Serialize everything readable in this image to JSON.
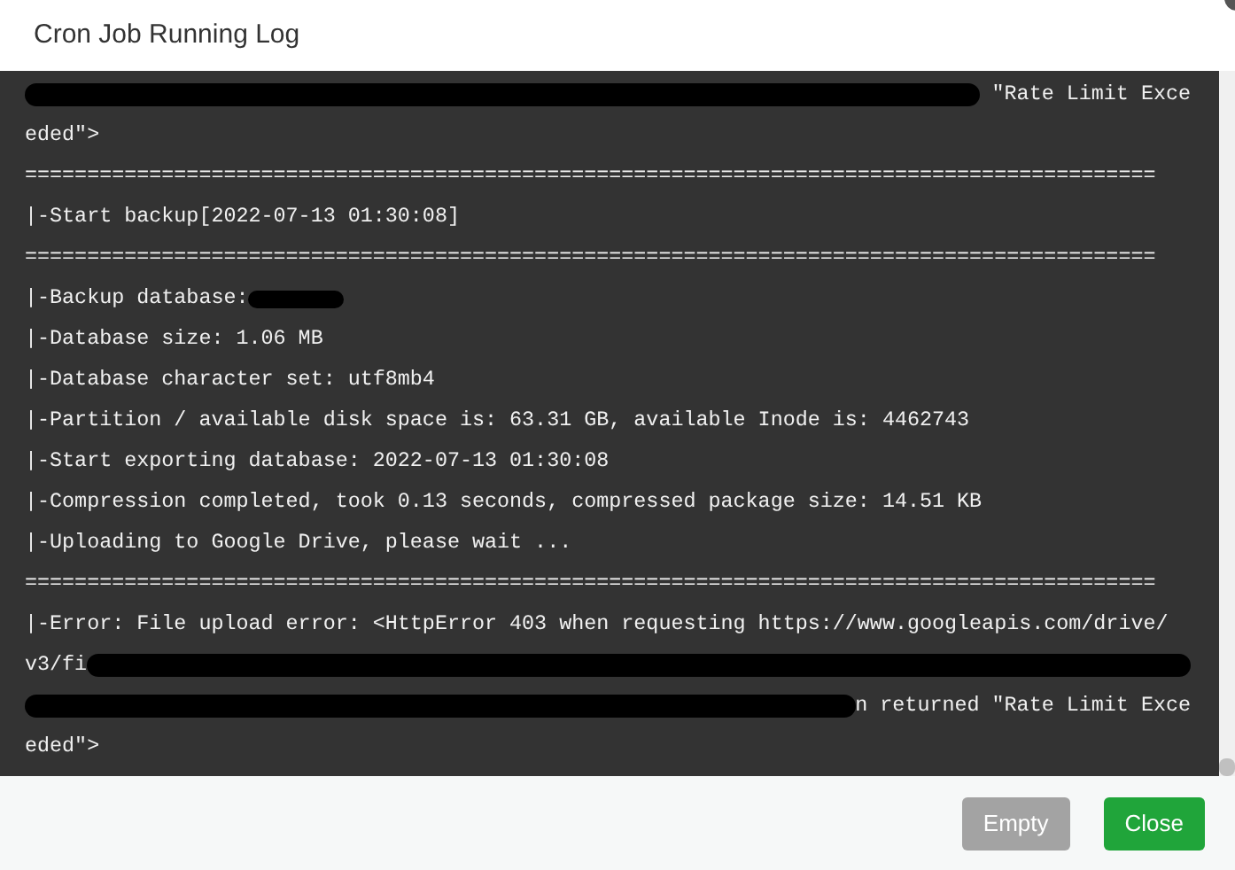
{
  "dialog": {
    "title": "Cron Job Running Log"
  },
  "log": {
    "lines": [
      {
        "segments": [
          {
            "kind": "redaction"
          },
          {
            "kind": "text",
            "text": " \"Rate Limit Exce"
          }
        ]
      },
      {
        "segments": [
          {
            "kind": "text",
            "text": "eded\">"
          }
        ]
      },
      {
        "segments": [
          {
            "kind": "text",
            "text": "==========================================================================================="
          }
        ]
      },
      {
        "segments": [
          {
            "kind": "text",
            "text": "|-Start backup[2022-07-13 01:30:08]"
          }
        ]
      },
      {
        "segments": [
          {
            "kind": "text",
            "text": "==========================================================================================="
          }
        ]
      },
      {
        "segments": [
          {
            "kind": "text",
            "text": "|-Backup database:"
          },
          {
            "kind": "smudge"
          }
        ]
      },
      {
        "segments": [
          {
            "kind": "text",
            "text": "|-Database size: 1.06 MB"
          }
        ]
      },
      {
        "segments": [
          {
            "kind": "text",
            "text": "|-Database character set: utf8mb4"
          }
        ]
      },
      {
        "segments": [
          {
            "kind": "text",
            "text": "|-Partition / available disk space is: 63.31 GB, available Inode is: 4462743"
          }
        ]
      },
      {
        "segments": [
          {
            "kind": "text",
            "text": "|-Start exporting database: 2022-07-13 01:30:08"
          }
        ]
      },
      {
        "segments": [
          {
            "kind": "text",
            "text": "|-Compression completed, took 0.13 seconds, compressed package size: 14.51 KB"
          }
        ]
      },
      {
        "segments": [
          {
            "kind": "text",
            "text": "|-Uploading to Google Drive, please wait ..."
          }
        ]
      },
      {
        "segments": [
          {
            "kind": "text",
            "text": "==========================================================================================="
          }
        ]
      },
      {
        "segments": [
          {
            "kind": "text",
            "text": "|-Error: File upload error: <HttpError 403 when requesting https://www.googleapis.com/drive/"
          }
        ]
      },
      {
        "segments": [
          {
            "kind": "text",
            "text": "v3/fi"
          },
          {
            "kind": "redaction"
          }
        ]
      },
      {
        "segments": [
          {
            "kind": "redaction"
          },
          {
            "kind": "text",
            "text": "n returned \"Rate Limit Exce"
          }
        ]
      },
      {
        "segments": [
          {
            "kind": "text",
            "text": "eded\">"
          }
        ]
      }
    ]
  },
  "buttons": [
    {
      "label": "Empty",
      "kind": "secondary",
      "disabled": true
    },
    {
      "label": "Close",
      "kind": "primary",
      "disabled": false
    }
  ]
}
